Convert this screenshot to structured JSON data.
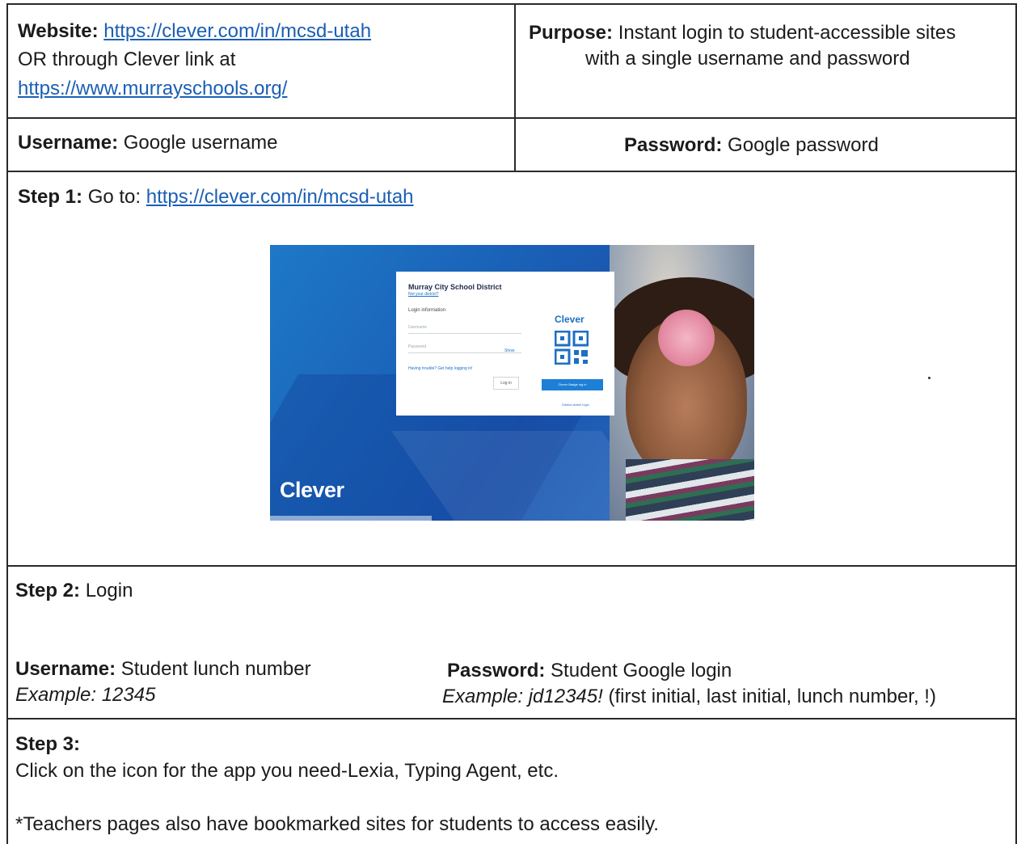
{
  "row1": {
    "website_label": "Website:",
    "website_url": "https://clever.com/in/mcsd-utah",
    "or_text": "OR through Clever link at",
    "murray_url": "https://www.murrayschools.org/",
    "purpose_label": "Purpose:",
    "purpose_line1": "Instant login to student-accessible sites",
    "purpose_line2": "with a single username and password"
  },
  "row2": {
    "username_label": "Username:",
    "username_value": "Google username",
    "password_label": "Password:",
    "password_value": "Google password"
  },
  "step1": {
    "label": "Step 1:",
    "text": "Go to:",
    "url": "https://clever.com/in/mcsd-utah"
  },
  "screenshot": {
    "district": "Murray City School District",
    "not_district": "Not your district?",
    "login_info": "Login information",
    "username_ph": "Username",
    "password_ph": "Password",
    "show": "Show",
    "trouble": "Having trouble? Get help logging in!",
    "login_btn": "Log in",
    "clever_small": "Clever",
    "badge_btn": "Clever Badge log in",
    "help_link": "District admin login",
    "clever_logo": "Clever"
  },
  "step2": {
    "label": "Step 2:",
    "text": "Login",
    "username_label": "Username:",
    "username_value": "Student lunch number",
    "username_example": "Example: 12345",
    "password_label": "Password:",
    "password_value": "Student Google login",
    "password_example_italic": "Example: jd12345!",
    "password_example_note": "(first initial, last initial, lunch number, !)"
  },
  "step3": {
    "label": "Step 3:",
    "text": "Click on the icon for the app you need-Lexia, Typing Agent, etc.",
    "note": "*Teachers pages also have bookmarked sites for students to access easily."
  }
}
